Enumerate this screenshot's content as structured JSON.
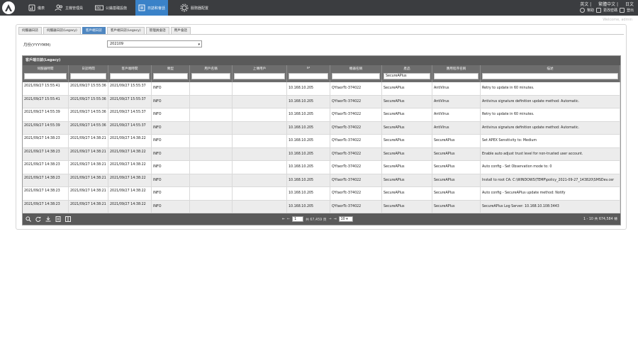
{
  "topbar": {
    "nav": [
      {
        "label": "儀表",
        "icon": "dashboard-icon"
      },
      {
        "label": "主機管理員",
        "icon": "users-icon"
      },
      {
        "label": "公鑰基礎設施",
        "icon": "pki-icon"
      },
      {
        "label": "日誌和會話",
        "icon": "logs-icon",
        "active": true
      },
      {
        "label": "服務器配置",
        "icon": "gear-icon"
      }
    ],
    "links": [
      "英文 |",
      "繁體中文 |",
      "日文"
    ],
    "icons": [
      {
        "label": "幫助"
      },
      {
        "label": "更改密碼"
      },
      {
        "label": "登出"
      }
    ],
    "welcome": "Welcome, admin"
  },
  "tabs": [
    {
      "label": "伺服器日誌"
    },
    {
      "label": "伺服器日誌(Legacy)"
    },
    {
      "label": "客戶端日誌",
      "active": true
    },
    {
      "label": "客戶端日誌(Legacy)"
    },
    {
      "label": "管理員會話"
    },
    {
      "label": "用戶會話"
    }
  ],
  "filter": {
    "month_label": "月份(YYYYMM)",
    "month_value": "202109"
  },
  "grid": {
    "title": "客戶端日誌(Legacy)",
    "columns": [
      {
        "label": "伺服器時間",
        "filter": ""
      },
      {
        "label": "日誌時間",
        "filter": ""
      },
      {
        "label": "客戶端時間",
        "filter": ""
      },
      {
        "label": "類型",
        "filter": ""
      },
      {
        "label": "用戶名稱",
        "filter": ""
      },
      {
        "label": "上傳用戶",
        "filter": ""
      },
      {
        "label": "IP",
        "filter": ""
      },
      {
        "label": "機器名稱",
        "filter": ""
      },
      {
        "label": "產品",
        "filter": "SecureAPlus"
      },
      {
        "label": "應用程序名稱",
        "filter": ""
      },
      {
        "label": "描述",
        "filter": ""
      }
    ],
    "rows": [
      [
        "2021/09/27 15:55:41",
        "2021/09/27 15:55:36",
        "2021/09/27 15:55:37",
        "INFO",
        "",
        "",
        "10.168.10.205",
        "QYtaorTc-374022",
        "SecureAPlus",
        "AntiVirus",
        "Retry to update in 60 minutes."
      ],
      [
        "2021/09/27 15:55:41",
        "2021/09/27 15:55:36",
        "2021/09/27 15:55:37",
        "INFO",
        "",
        "",
        "10.168.10.205",
        "QYtaorTc-374022",
        "SecureAPlus",
        "AntiVirus",
        "Antivirus signature definition update method: Automatic."
      ],
      [
        "2021/09/27 14:55:39",
        "2021/09/27 14:55:36",
        "2021/09/27 14:55:37",
        "INFO",
        "",
        "",
        "10.168.10.205",
        "QYtaorTc-374022",
        "SecureAPlus",
        "AntiVirus",
        "Retry to update in 60 minutes."
      ],
      [
        "2021/09/27 14:55:39",
        "2021/09/27 14:55:36",
        "2021/09/27 14:55:37",
        "INFO",
        "",
        "",
        "10.168.10.205",
        "QYtaorTc-374022",
        "SecureAPlus",
        "AntiVirus",
        "Antivirus signature definition update method: Automatic."
      ],
      [
        "2021/09/27 14:38:23",
        "2021/09/27 14:38:21",
        "2021/09/27 14:38:22",
        "INFO",
        "",
        "",
        "10.168.10.205",
        "QYtaorTc-374022",
        "SecureAPlus",
        "SecureAPlus",
        "Set APEX Sensitivity to: Medium"
      ],
      [
        "2021/09/27 14:38:23",
        "2021/09/27 14:38:21",
        "2021/09/27 14:38:22",
        "INFO",
        "",
        "",
        "10.168.10.205",
        "QYtaorTc-374022",
        "SecureAPlus",
        "SecureAPlus",
        "Enable auto adjust trust level for non-trusted user account."
      ],
      [
        "2021/09/27 14:38:23",
        "2021/09/27 14:38:21",
        "2021/09/27 14:38:22",
        "INFO",
        "",
        "",
        "10.168.10.205",
        "QYtaorTc-374022",
        "SecureAPlus",
        "SecureAPlus",
        "Auto config - Set Observation mode to: 0"
      ],
      [
        "2021/09/27 14:38:23",
        "2021/09/27 14:38:21",
        "2021/09/27 14:38:22",
        "INFO",
        "",
        "",
        "10.168.10.205",
        "QYtaorTc-374022",
        "SecureAPlus",
        "SecureAPlus",
        "Install to root CA: C:\\WINDOWS\\TEMP\\policy_2021-09-27_143820\\SMSDev.cer"
      ],
      [
        "2021/09/27 14:38:23",
        "2021/09/27 14:38:21",
        "2021/09/27 14:38:22",
        "INFO",
        "",
        "",
        "10.168.10.205",
        "QYtaorTc-374022",
        "SecureAPlus",
        "SecureAPlus",
        "Auto config - SecureAPlus update method: Notify"
      ],
      [
        "2021/09/27 14:38:23",
        "2021/09/27 14:38:21",
        "2021/09/27 14:38:22",
        "INFO",
        "",
        "",
        "10.168.10.205",
        "QYtaorTc-374022",
        "SecureAPlus",
        "SecureAPlus",
        "SecureAPlus Log Server: 10.168.10.108:3443"
      ]
    ],
    "footer": {
      "icons": [
        "search-icon",
        "refresh-icon",
        "download-icon",
        "export-icon",
        "columns-icon"
      ],
      "page_value": "1",
      "page_total": "共 67,459 頁",
      "page_size": "10",
      "record_info": "1 - 10 共 674,584 條"
    }
  }
}
